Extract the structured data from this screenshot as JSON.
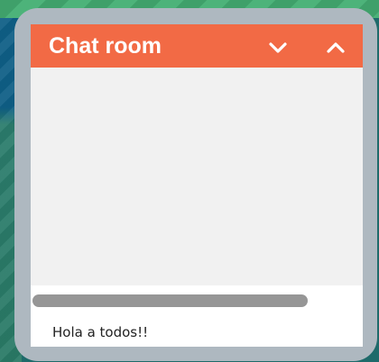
{
  "chat": {
    "title": "Chat room",
    "icons": {
      "collapse": "chevron-down-icon",
      "expand": "chevron-up-icon"
    },
    "input_text": "Hola a todos!!"
  },
  "colors": {
    "header": "#f26a45",
    "frame": "#aeb8c0",
    "messages_bg": "#f1f1f1",
    "scrollbar": "#969696"
  }
}
